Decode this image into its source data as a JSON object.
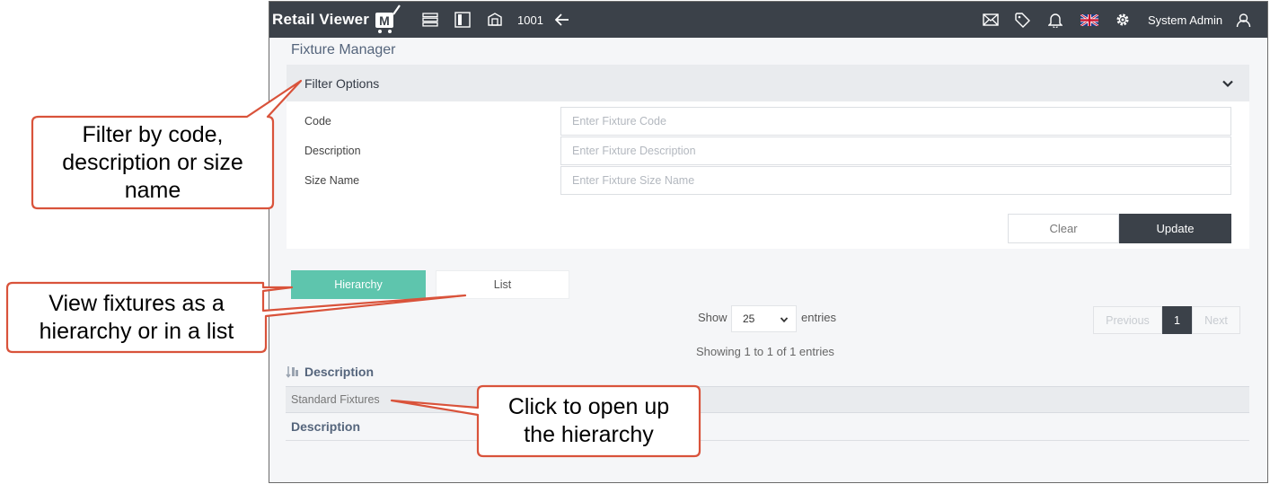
{
  "topbar": {
    "logo_text": "Retail Viewer",
    "logo_badge": "M",
    "store_code": "1001",
    "user_name": "System Admin",
    "icons": [
      "menu-icon",
      "panel-icon",
      "fixture-icon",
      "back-arrow-icon",
      "mail-icon",
      "tag-icon",
      "bell-icon",
      "uk-flag-icon",
      "gear-icon",
      "user-icon"
    ]
  },
  "page": {
    "title": "Fixture Manager"
  },
  "filter": {
    "title": "Filter Options",
    "fields": [
      {
        "label": "Code",
        "placeholder": "Enter Fixture Code",
        "value": ""
      },
      {
        "label": "Description",
        "placeholder": "Enter Fixture Description",
        "value": ""
      },
      {
        "label": "Size Name",
        "placeholder": "Enter Fixture Size Name",
        "value": ""
      }
    ],
    "clear_label": "Clear",
    "update_label": "Update"
  },
  "tabs": {
    "hierarchy": "Hierarchy",
    "list": "List"
  },
  "table_controls": {
    "show_label": "Show",
    "entries_value": "25",
    "entries_label": "entries",
    "prev_label": "Previous",
    "page_label": "1",
    "next_label": "Next",
    "showing_info": "Showing 1 to 1 of 1 entries"
  },
  "table": {
    "header": "Description",
    "rows": [
      "Standard Fixtures"
    ],
    "footer": "Description"
  },
  "callouts": [
    {
      "text": "Filter by code,\ndescription or size\nname"
    },
    {
      "text": "View fixtures as a\nhierarchy or in a list"
    },
    {
      "text": "Click to open up\nthe hierarchy"
    }
  ],
  "colors": {
    "topbar": "#3b4149",
    "accent_teal": "#5ec5ad",
    "callout_border": "#d9533b",
    "heading": "#55657c"
  }
}
